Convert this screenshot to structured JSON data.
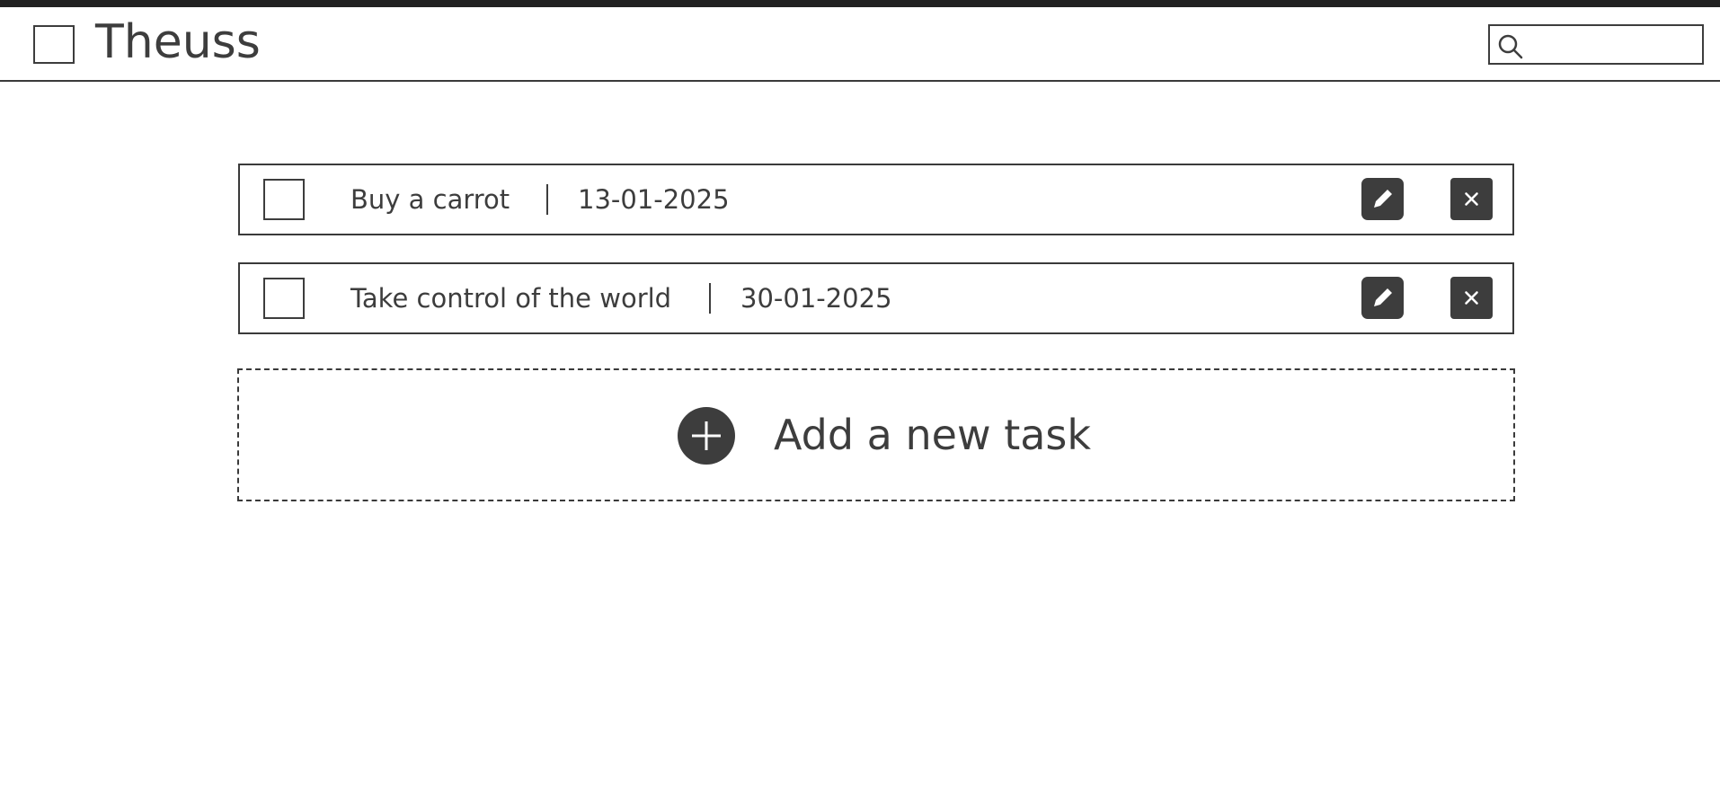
{
  "header": {
    "title": "Theuss",
    "search": {
      "value": "",
      "placeholder": ""
    }
  },
  "tasks": [
    {
      "name": "Buy a carrot",
      "date": "13-01-2025",
      "done": false
    },
    {
      "name": "Take control of the world",
      "date": "30-01-2025",
      "done": false
    }
  ],
  "add_task": {
    "label": "Add a new task"
  },
  "icons": {
    "search": "search-icon",
    "edit": "pencil-icon",
    "delete": "close-icon",
    "add": "plus-circle-icon"
  },
  "colors": {
    "ink": "#3d3d3d",
    "top_strip": "#222222",
    "background": "#ffffff"
  }
}
